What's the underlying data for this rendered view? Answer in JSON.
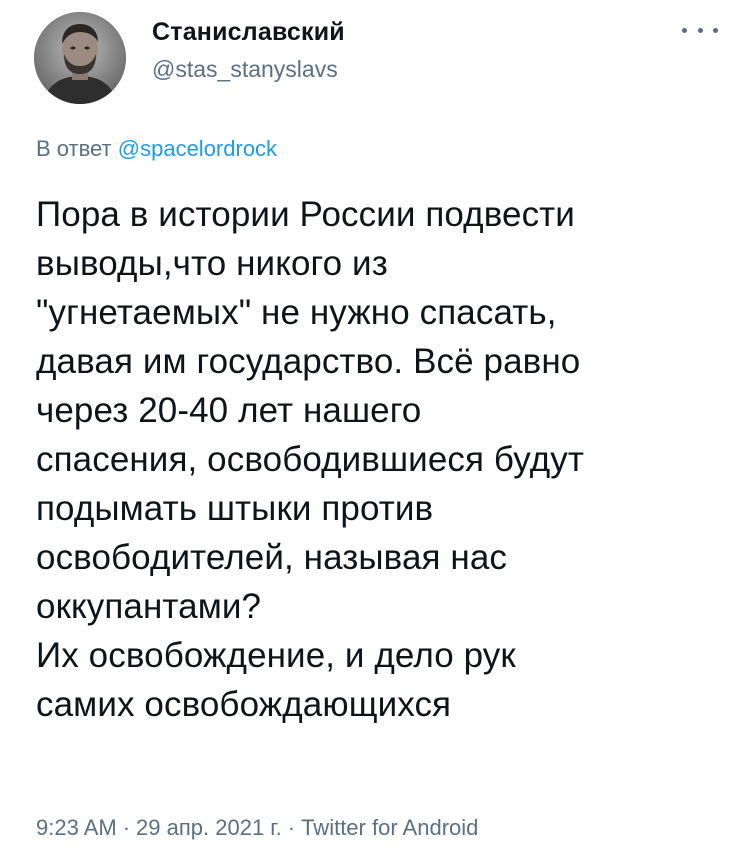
{
  "author": {
    "name": "Станиславский",
    "handle": "@stas_stanyslavs",
    "avatar_icon": "avatar-photo"
  },
  "reply": {
    "prefix": "В ответ",
    "to": "@spacelordrock"
  },
  "tweet": {
    "text": "Пора в истории России подвести\nвыводы,что никого из\n\"угнетаемых\" не нужно спасать,\nдавая им государство. Всё равно\nчерез 20-40 лет нашего\nспасения, освободившиеся будут\nподымать штыки против\nосвободителей, называя нас\nоккупантами?\nИх освобождение, и дело рук\nсамих освобождающихся"
  },
  "meta": {
    "time": "9:23 AM",
    "date": "29 апр. 2021 г.",
    "client": "Twitter for Android",
    "separator": "·"
  },
  "icons": {
    "more": "more-horizontal-icon"
  },
  "colors": {
    "text": "#0f1419",
    "secondary": "#5b7083",
    "link": "#1d9bf0",
    "background": "#ffffff"
  }
}
